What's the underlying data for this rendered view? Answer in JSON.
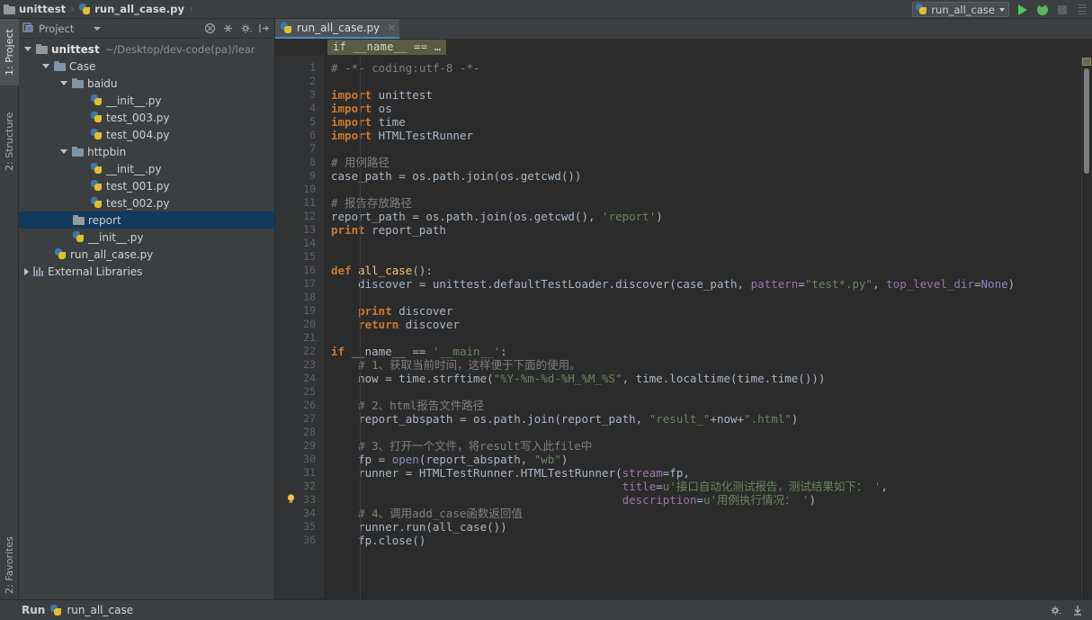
{
  "titlebar": {
    "project_name": "unittest",
    "file_name": "run_all_case.py",
    "separator": "›",
    "project_icon": "folder-icon",
    "file_icon": "python-file-icon",
    "run_config": {
      "name": "run_all_case",
      "icon": "python-file-icon",
      "dropdown_icon": "chevron-down-icon",
      "run_icon": "run-play-icon",
      "debug_icon": "debug-bug-icon",
      "stop_icon": "stop-icon",
      "more_icon": "more-bars-icon"
    }
  },
  "left_tool_tabs": [
    {
      "label": "1: Project",
      "selected": true,
      "icon": "project-icon"
    },
    {
      "label": "2: Structure",
      "selected": false,
      "icon": "structure-icon"
    }
  ],
  "bottom_tool_tab": {
    "label": "2: Favorites",
    "icon": "favorites-icon"
  },
  "project_panel": {
    "title": "Project",
    "title_icon": "project-panel-icon",
    "dropdown_icon": "chevron-down-icon",
    "toolbar": [
      {
        "name": "collapse-scope-icon",
        "label": ""
      },
      {
        "name": "collapse-all-icon",
        "label": ""
      },
      {
        "name": "settings-gear-icon",
        "label": ""
      },
      {
        "name": "hide-panel-icon",
        "label": ""
      }
    ],
    "tree": [
      {
        "depth": 0,
        "label": "unittest",
        "path": "~/Desktop/dev-code(pa)/lear",
        "icon": "folder-icon",
        "twisty": "open",
        "bold": true,
        "selected": false
      },
      {
        "depth": 1,
        "label": "Case",
        "icon": "module-folder-icon",
        "twisty": "open",
        "bold": false,
        "selected": false
      },
      {
        "depth": 2,
        "label": "baidu",
        "icon": "module-folder-icon",
        "twisty": "open",
        "bold": false,
        "selected": false
      },
      {
        "depth": 3,
        "label": "__init__.py",
        "icon": "python-file-icon",
        "twisty": "none",
        "bold": false,
        "selected": false
      },
      {
        "depth": 3,
        "label": "test_003.py",
        "icon": "python-file-icon",
        "twisty": "none",
        "bold": false,
        "selected": false
      },
      {
        "depth": 3,
        "label": "test_004.py",
        "icon": "python-file-icon",
        "twisty": "none",
        "bold": false,
        "selected": false
      },
      {
        "depth": 2,
        "label": "httpbin",
        "icon": "module-folder-icon",
        "twisty": "open",
        "bold": false,
        "selected": false
      },
      {
        "depth": 3,
        "label": "__init__.py",
        "icon": "python-file-icon",
        "twisty": "none",
        "bold": false,
        "selected": false
      },
      {
        "depth": 3,
        "label": "test_001.py",
        "icon": "python-file-icon",
        "twisty": "none",
        "bold": false,
        "selected": false
      },
      {
        "depth": 3,
        "label": "test_002.py",
        "icon": "python-file-icon",
        "twisty": "none",
        "bold": false,
        "selected": false
      },
      {
        "depth": 2,
        "label": "report",
        "icon": "folder-icon",
        "twisty": "none",
        "bold": false,
        "selected": true
      },
      {
        "depth": 2,
        "label": "__init__.py",
        "icon": "python-file-icon",
        "twisty": "none",
        "bold": false,
        "selected": false
      },
      {
        "depth": 1,
        "label": "run_all_case.py",
        "icon": "python-file-icon",
        "twisty": "none",
        "bold": false,
        "selected": false
      },
      {
        "depth": 0,
        "label": "External Libraries",
        "icon": "library-icon",
        "twisty": "closed",
        "bold": false,
        "selected": false
      }
    ]
  },
  "editor": {
    "tab": {
      "label": "run_all_case.py",
      "icon": "python-file-icon",
      "close_icon": "close-icon"
    },
    "breadcrumb": "if __name__ == …",
    "first_line": 1,
    "last_line": 36,
    "gutter_bulb_line": 33,
    "fold_lines": [
      3,
      6,
      16,
      20,
      22,
      36
    ],
    "lines": [
      {
        "n": 1,
        "tokens": [
          {
            "t": "# -*- coding:utf-8 -*-",
            "c": "c"
          }
        ]
      },
      {
        "n": 2,
        "tokens": []
      },
      {
        "n": 3,
        "tokens": [
          {
            "t": "import",
            "c": "k"
          },
          {
            "t": " unittest",
            "c": "df"
          }
        ]
      },
      {
        "n": 4,
        "tokens": [
          {
            "t": "import",
            "c": "k"
          },
          {
            "t": " os",
            "c": "df"
          }
        ]
      },
      {
        "n": 5,
        "tokens": [
          {
            "t": "import",
            "c": "k"
          },
          {
            "t": " time",
            "c": "df"
          }
        ]
      },
      {
        "n": 6,
        "tokens": [
          {
            "t": "import",
            "c": "k"
          },
          {
            "t": " HTMLTestRunner",
            "c": "df"
          }
        ]
      },
      {
        "n": 7,
        "tokens": []
      },
      {
        "n": 8,
        "tokens": [
          {
            "t": "# 用例路径",
            "c": "c"
          }
        ]
      },
      {
        "n": 9,
        "tokens": [
          {
            "t": "case_path = os.path.join(os.getcwd())",
            "c": "df"
          }
        ]
      },
      {
        "n": 10,
        "tokens": []
      },
      {
        "n": 11,
        "tokens": [
          {
            "t": "# 报告存放路径",
            "c": "c"
          }
        ]
      },
      {
        "n": 12,
        "tokens": [
          {
            "t": "report_path = os.path.join(os.getcwd(), ",
            "c": "df"
          },
          {
            "t": "'report'",
            "c": "s"
          },
          {
            "t": ")",
            "c": "df"
          }
        ]
      },
      {
        "n": 13,
        "tokens": [
          {
            "t": "print",
            "c": "k"
          },
          {
            "t": " report_path",
            "c": "df"
          }
        ]
      },
      {
        "n": 14,
        "tokens": []
      },
      {
        "n": 15,
        "tokens": []
      },
      {
        "n": 16,
        "tokens": [
          {
            "t": "def",
            "c": "k"
          },
          {
            "t": " ",
            "c": "df"
          },
          {
            "t": "all_case",
            "c": "fn"
          },
          {
            "t": "():",
            "c": "df"
          }
        ]
      },
      {
        "n": 17,
        "tokens": [
          {
            "t": "    discover = unittest.defaultTestLoader.discover(case_path, ",
            "c": "df"
          },
          {
            "t": "pattern",
            "c": "kw"
          },
          {
            "t": "=",
            "c": "df"
          },
          {
            "t": "\"test*.py\"",
            "c": "s"
          },
          {
            "t": ", ",
            "c": "df"
          },
          {
            "t": "top_level_dir",
            "c": "kw"
          },
          {
            "t": "=",
            "c": "df"
          },
          {
            "t": "None",
            "c": "bi"
          },
          {
            "t": ")",
            "c": "df"
          }
        ]
      },
      {
        "n": 18,
        "tokens": []
      },
      {
        "n": 19,
        "tokens": [
          {
            "t": "    ",
            "c": "df"
          },
          {
            "t": "print",
            "c": "k"
          },
          {
            "t": " discover",
            "c": "df"
          }
        ]
      },
      {
        "n": 20,
        "tokens": [
          {
            "t": "    ",
            "c": "df"
          },
          {
            "t": "return",
            "c": "k"
          },
          {
            "t": " discover",
            "c": "df"
          }
        ]
      },
      {
        "n": 21,
        "tokens": []
      },
      {
        "n": 22,
        "tokens": [
          {
            "t": "if",
            "c": "k"
          },
          {
            "t": " __name__ == ",
            "c": "df"
          },
          {
            "t": "'__main__'",
            "c": "s"
          },
          {
            "t": ":",
            "c": "df"
          }
        ]
      },
      {
        "n": 23,
        "tokens": [
          {
            "t": "    # 1、获取当前时间，这样便于下面的使用。",
            "c": "c"
          }
        ]
      },
      {
        "n": 24,
        "tokens": [
          {
            "t": "    now = time.strftime(",
            "c": "df"
          },
          {
            "t": "\"%Y-%m-%d-%H_%M_%S\"",
            "c": "s"
          },
          {
            "t": ", time.localtime(time.time()))",
            "c": "df"
          }
        ]
      },
      {
        "n": 25,
        "tokens": []
      },
      {
        "n": 26,
        "tokens": [
          {
            "t": "    # 2、html报告文件路径",
            "c": "c"
          }
        ]
      },
      {
        "n": 27,
        "tokens": [
          {
            "t": "    report_abspath = os.path.join(report_path, ",
            "c": "df"
          },
          {
            "t": "\"result_\"",
            "c": "s"
          },
          {
            "t": "+now+",
            "c": "df"
          },
          {
            "t": "\".html\"",
            "c": "s"
          },
          {
            "t": ")",
            "c": "df"
          }
        ]
      },
      {
        "n": 28,
        "tokens": []
      },
      {
        "n": 29,
        "tokens": [
          {
            "t": "    # 3、打开一个文件，将result写入此file中",
            "c": "c"
          }
        ]
      },
      {
        "n": 30,
        "tokens": [
          {
            "t": "    fp = ",
            "c": "df"
          },
          {
            "t": "open",
            "c": "bi"
          },
          {
            "t": "(report_abspath, ",
            "c": "df"
          },
          {
            "t": "\"wb\"",
            "c": "s"
          },
          {
            "t": ")",
            "c": "df"
          }
        ]
      },
      {
        "n": 31,
        "tokens": [
          {
            "t": "    runner = HTMLTestRunner.HTMLTestRunner(",
            "c": "df"
          },
          {
            "t": "stream",
            "c": "kw"
          },
          {
            "t": "=",
            "c": "df"
          },
          {
            "t": "fp,",
            "c": "df"
          }
        ]
      },
      {
        "n": 32,
        "tokens": [
          {
            "t": "                                           ",
            "c": "df"
          },
          {
            "t": "title",
            "c": "kw"
          },
          {
            "t": "=",
            "c": "df"
          },
          {
            "t": "u'接口自动化测试报告，测试结果如下： '",
            "c": "s"
          },
          {
            "t": ",",
            "c": "df"
          }
        ]
      },
      {
        "n": 33,
        "tokens": [
          {
            "t": "                                           ",
            "c": "df"
          },
          {
            "t": "description",
            "c": "kw"
          },
          {
            "t": "=",
            "c": "df"
          },
          {
            "t": "u'用例执行情况： '",
            "c": "s"
          },
          {
            "t": ")",
            "c": "df"
          }
        ]
      },
      {
        "n": 34,
        "tokens": [
          {
            "t": "    # 4、调用add_case函数返回值",
            "c": "c"
          }
        ]
      },
      {
        "n": 35,
        "tokens": [
          {
            "t": "    runner.run(all_case())",
            "c": "df"
          }
        ]
      },
      {
        "n": 36,
        "tokens": [
          {
            "t": "    fp.close()",
            "c": "df"
          }
        ]
      }
    ]
  },
  "statusbar": {
    "run_label": "Run",
    "run_icon": "python-file-icon",
    "run_target": "run_all_case",
    "gear_icon": "settings-gear-icon",
    "install_icon": "install-plugin-icon"
  },
  "colors": {
    "window_bg": "#3c3f41",
    "editor_bg": "#2b2b2b",
    "gutter_bg": "#313335",
    "selection_blue": "#113a5c",
    "tab_underline": "#4a88c7",
    "keyword": "#cc7832",
    "string": "#6a8759",
    "comment": "#808080",
    "named_arg": "#9876aa",
    "function": "#ffc66d",
    "builtin": "#8888c6",
    "default_text": "#a9b7c6",
    "breadcrumb_chip": "#5b5b44"
  }
}
